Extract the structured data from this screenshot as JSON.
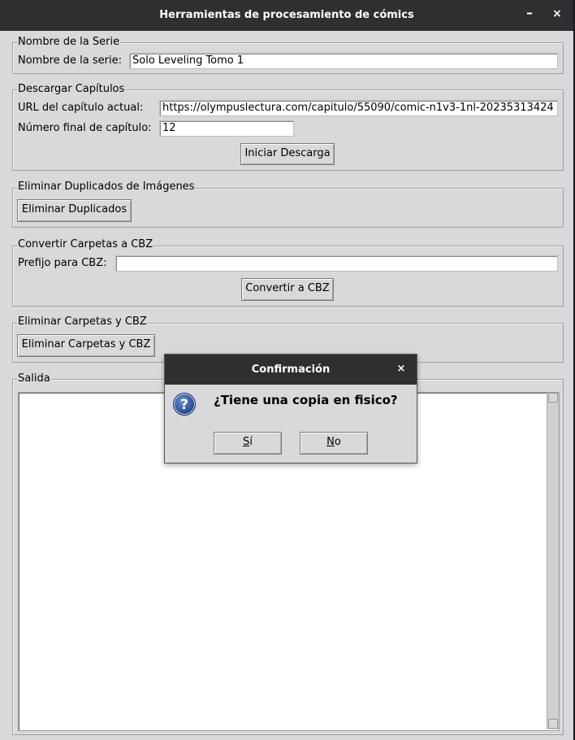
{
  "window": {
    "title": "Herramientas de procesamiento de cómics",
    "minimize_glyph": "–",
    "close_glyph": "×"
  },
  "serie": {
    "legend": "Nombre de la Serie",
    "label": "Nombre de la serie:",
    "value": "Solo Leveling Tomo 1"
  },
  "descargar": {
    "legend": "Descargar Capítulos",
    "url_label": "URL del capítulo actual:",
    "url_value": "https://olympuslectura.com/capitulo/55090/comic-n1v3-1nl-20235313424",
    "num_label": "Número final de capítulo:",
    "num_value": "12",
    "button": "Iniciar Descarga"
  },
  "duplicados": {
    "legend": "Eliminar Duplicados de Imágenes",
    "button": "Eliminar Duplicados"
  },
  "cbz": {
    "legend": "Convertir Carpetas a CBZ",
    "label": "Prefijo para CBZ:",
    "value": "",
    "button": "Convertir a CBZ"
  },
  "eliminar": {
    "legend": "Eliminar Carpetas y CBZ",
    "button": "Eliminar Carpetas y CBZ"
  },
  "salida": {
    "legend": "Salida"
  },
  "dialog": {
    "title": "Confirmación",
    "close_glyph": "×",
    "icon": "question-icon",
    "icon_glyph": "?",
    "message": "¿Tiene una copia en fisico?",
    "yes_mnemonic": "S",
    "yes_rest": "í",
    "no_mnemonic": "N",
    "no_rest": "o"
  }
}
